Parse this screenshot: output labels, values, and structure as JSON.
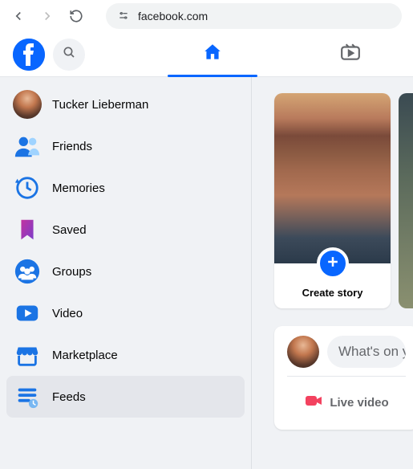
{
  "browser": {
    "url": "facebook.com"
  },
  "user": {
    "name": "Tucker Lieberman"
  },
  "sidebar": {
    "items": [
      {
        "label": "Tucker Lieberman"
      },
      {
        "label": "Friends"
      },
      {
        "label": "Memories"
      },
      {
        "label": "Saved"
      },
      {
        "label": "Groups"
      },
      {
        "label": "Video"
      },
      {
        "label": "Marketplace"
      },
      {
        "label": "Feeds"
      }
    ]
  },
  "stories": {
    "create_label": "Create story"
  },
  "composer": {
    "placeholder": "What's on y",
    "live_label": "Live video"
  }
}
